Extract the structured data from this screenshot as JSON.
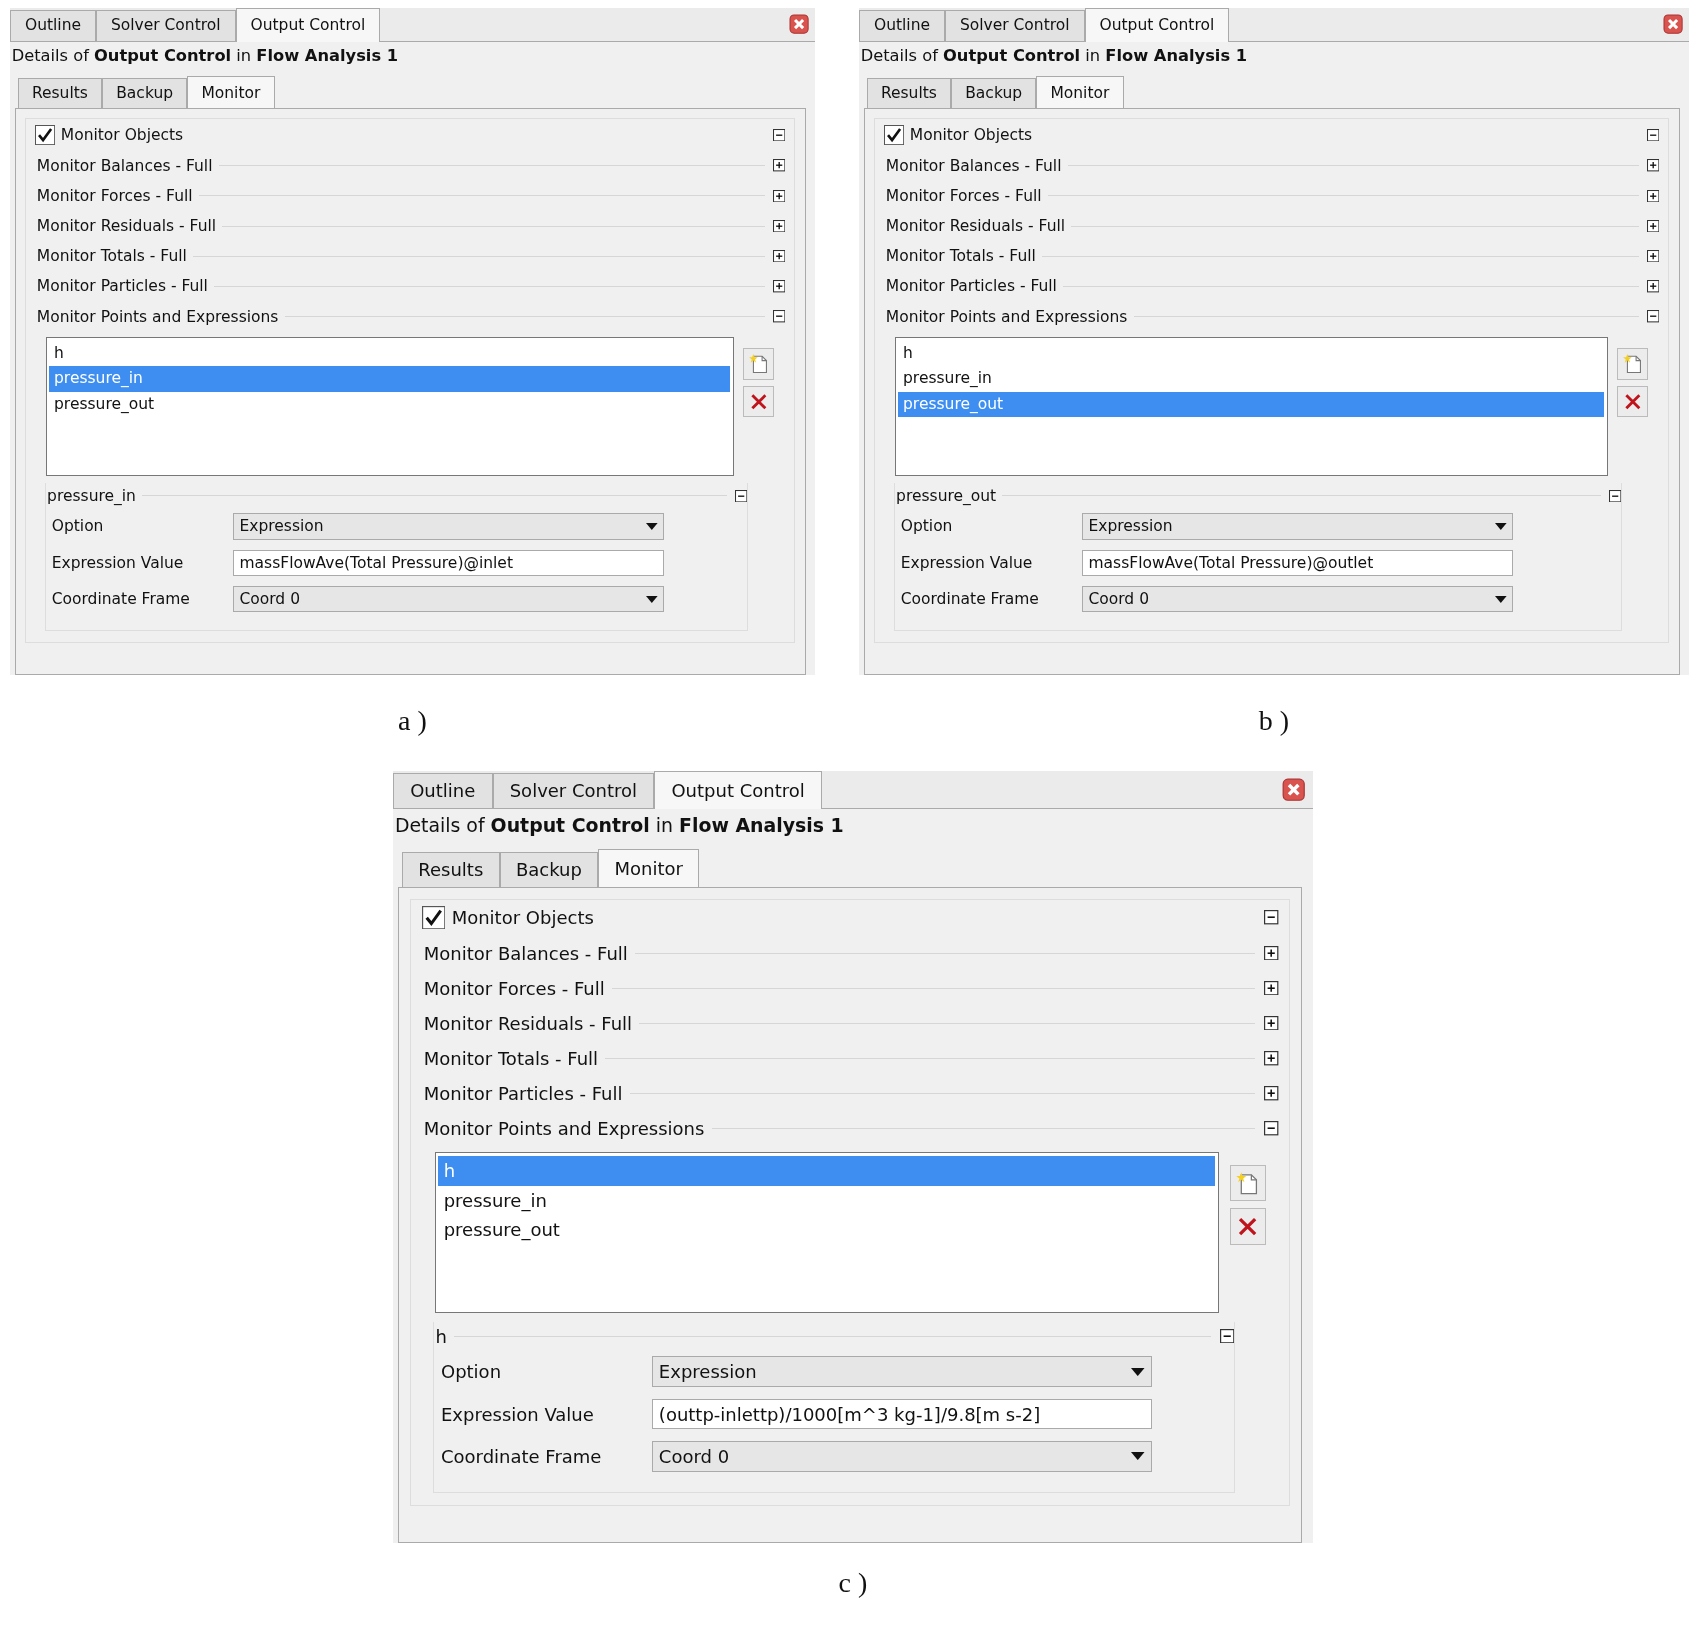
{
  "figures": [
    {
      "caption": "a )",
      "panel": {
        "top_tabs": [
          {
            "label": "Outline",
            "selected": false
          },
          {
            "label": "Solver Control",
            "selected": false
          },
          {
            "label": "Output Control",
            "selected": true
          }
        ],
        "details": "Details of **Output Control** in **Flow Analysis 1**",
        "sub_tabs": [
          {
            "label": "Results",
            "selected": false
          },
          {
            "label": "Backup",
            "selected": false
          },
          {
            "label": "Monitor",
            "selected": true
          }
        ],
        "monitor_objects": {
          "label": "Monitor Objects",
          "checked": true,
          "expanded": true
        },
        "sections": [
          {
            "label": "Monitor Balances - Full",
            "expanded": false
          },
          {
            "label": "Monitor Forces - Full",
            "expanded": false
          },
          {
            "label": "Monitor Residuals - Full",
            "expanded": false
          },
          {
            "label": "Monitor Totals - Full",
            "expanded": false
          },
          {
            "label": "Monitor Particles - Full",
            "expanded": false
          },
          {
            "label": "Monitor Points and Expressions",
            "expanded": true
          }
        ],
        "list_items": [
          {
            "label": "h",
            "selected": false
          },
          {
            "label": "pressure_in",
            "selected": true
          },
          {
            "label": "pressure_out",
            "selected": false
          }
        ],
        "detail_group": {
          "title": "pressure_in",
          "expanded": true,
          "fields": [
            {
              "kind": "dropdown",
              "label": "Option",
              "value": "Expression"
            },
            {
              "kind": "text",
              "label": "Expression Value",
              "value": "massFlowAve(Total Pressure)@inlet"
            },
            {
              "kind": "dropdown",
              "label": "Coordinate Frame",
              "value": "Coord 0"
            }
          ]
        }
      }
    },
    {
      "caption": "b )",
      "panel": {
        "top_tabs": [
          {
            "label": "Outline",
            "selected": false
          },
          {
            "label": "Solver Control",
            "selected": false
          },
          {
            "label": "Output Control",
            "selected": true
          }
        ],
        "details": "Details of **Output Control** in **Flow Analysis 1**",
        "sub_tabs": [
          {
            "label": "Results",
            "selected": false
          },
          {
            "label": "Backup",
            "selected": false
          },
          {
            "label": "Monitor",
            "selected": true
          }
        ],
        "monitor_objects": {
          "label": "Monitor Objects",
          "checked": true,
          "expanded": true
        },
        "sections": [
          {
            "label": "Monitor Balances - Full",
            "expanded": false
          },
          {
            "label": "Monitor Forces - Full",
            "expanded": false
          },
          {
            "label": "Monitor Residuals - Full",
            "expanded": false
          },
          {
            "label": "Monitor Totals - Full",
            "expanded": false
          },
          {
            "label": "Monitor Particles - Full",
            "expanded": false
          },
          {
            "label": "Monitor Points and Expressions",
            "expanded": true
          }
        ],
        "list_items": [
          {
            "label": "h",
            "selected": false
          },
          {
            "label": "pressure_in",
            "selected": false
          },
          {
            "label": "pressure_out",
            "selected": true
          }
        ],
        "detail_group": {
          "title": "pressure_out",
          "expanded": true,
          "fields": [
            {
              "kind": "dropdown",
              "label": "Option",
              "value": "Expression"
            },
            {
              "kind": "text",
              "label": "Expression Value",
              "value": "massFlowAve(Total Pressure)@outlet"
            },
            {
              "kind": "dropdown",
              "label": "Coordinate Frame",
              "value": "Coord 0"
            }
          ]
        }
      }
    },
    {
      "caption": "c )",
      "panel": {
        "top_tabs": [
          {
            "label": "Outline",
            "selected": false
          },
          {
            "label": "Solver Control",
            "selected": false
          },
          {
            "label": "Output Control",
            "selected": true
          }
        ],
        "details": "Details of **Output Control** in **Flow Analysis 1**",
        "sub_tabs": [
          {
            "label": "Results",
            "selected": false
          },
          {
            "label": "Backup",
            "selected": false
          },
          {
            "label": "Monitor",
            "selected": true
          }
        ],
        "monitor_objects": {
          "label": "Monitor Objects",
          "checked": true,
          "expanded": true
        },
        "sections": [
          {
            "label": "Monitor Balances - Full",
            "expanded": false
          },
          {
            "label": "Monitor Forces - Full",
            "expanded": false
          },
          {
            "label": "Monitor Residuals - Full",
            "expanded": false
          },
          {
            "label": "Monitor Totals - Full",
            "expanded": false
          },
          {
            "label": "Monitor Particles - Full",
            "expanded": false
          },
          {
            "label": "Monitor Points and Expressions",
            "expanded": true
          }
        ],
        "list_items": [
          {
            "label": "h",
            "selected": true
          },
          {
            "label": "pressure_in",
            "selected": false
          },
          {
            "label": "pressure_out",
            "selected": false
          }
        ],
        "detail_group": {
          "title": "h",
          "expanded": true,
          "fields": [
            {
              "kind": "dropdown",
              "label": "Option",
              "value": "Expression"
            },
            {
              "kind": "text",
              "label": "Expression Value",
              "value": "(outtp-inlettp)/1000[m^3 kg-1]/9.8[m s-2]"
            },
            {
              "kind": "dropdown",
              "label": "Coordinate Frame",
              "value": "Coord 0"
            }
          ]
        }
      }
    }
  ]
}
